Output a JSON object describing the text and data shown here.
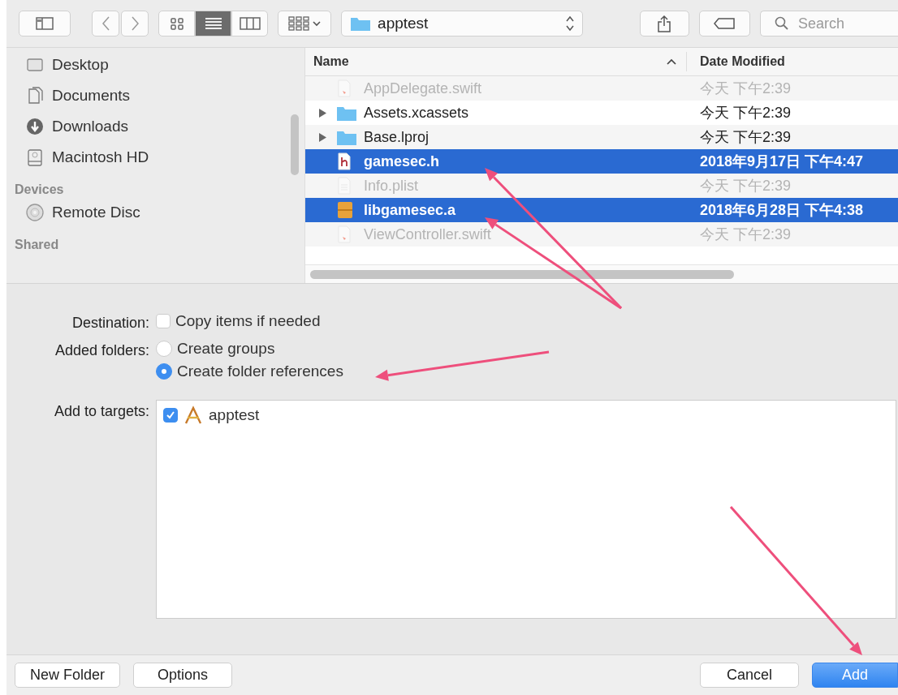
{
  "toolbar": {
    "view_modes": [
      {
        "kind": "icons",
        "selected": false
      },
      {
        "kind": "list",
        "selected": true
      },
      {
        "kind": "columns",
        "selected": false
      }
    ],
    "location": "apptest",
    "search": {
      "placeholder": "Search"
    }
  },
  "sidebar": {
    "sections": [
      {
        "items": [
          {
            "label": "Desktop",
            "kind": "desktop"
          },
          {
            "label": "Documents",
            "kind": "documents"
          },
          {
            "label": "Downloads",
            "kind": "downloads"
          },
          {
            "label": "Macintosh HD",
            "kind": "disk"
          }
        ]
      },
      {
        "heading": "Devices",
        "items": [
          {
            "label": "Remote Disc",
            "kind": "disc"
          }
        ]
      },
      {
        "heading": "Shared"
      }
    ]
  },
  "file_list": {
    "columns": [
      {
        "label": "Name",
        "sorted": true
      },
      {
        "label": "Date Modified",
        "sorted": false
      }
    ],
    "rows": [
      {
        "name": "AppDelegate.swift",
        "date": "今天 下午2:39",
        "kind": "swift",
        "expandable": false,
        "dimmed": true,
        "selected": false
      },
      {
        "name": "Assets.xcassets",
        "date": "今天 下午2:39",
        "kind": "folder",
        "expandable": true,
        "dimmed": false,
        "selected": false
      },
      {
        "name": "Base.lproj",
        "date": "今天 下午2:39",
        "kind": "folder",
        "expandable": true,
        "dimmed": false,
        "selected": false
      },
      {
        "name": "gamesec.h",
        "date": "2018年9月17日 下午4:47",
        "kind": "header",
        "expandable": false,
        "dimmed": false,
        "selected": true
      },
      {
        "name": "Info.plist",
        "date": "今天 下午2:39",
        "kind": "plist",
        "expandable": false,
        "dimmed": true,
        "selected": false
      },
      {
        "name": "libgamesec.a",
        "date": "2018年6月28日 下午4:38",
        "kind": "library",
        "expandable": false,
        "dimmed": false,
        "selected": true
      },
      {
        "name": "ViewController.swift",
        "date": "今天 下午2:39",
        "kind": "swift",
        "expandable": false,
        "dimmed": true,
        "selected": false
      }
    ]
  },
  "options": [
    {
      "label": "Destination:",
      "kind": "checkbox",
      "choices": [
        {
          "text": "Copy items if needed",
          "checked": false
        }
      ]
    },
    {
      "label": "Added folders:",
      "kind": "radio",
      "choices": [
        {
          "text": "Create groups",
          "selected": false
        },
        {
          "text": "Create folder references",
          "selected": true
        }
      ]
    },
    {
      "label": "Add to targets:",
      "kind": "targets",
      "choices": [
        {
          "text": "apptest",
          "checked": true
        }
      ]
    }
  ],
  "left_buttons": [
    {
      "label": "New Folder",
      "kind": "plain"
    },
    {
      "label": "Options",
      "kind": "plain"
    }
  ],
  "right_buttons": [
    {
      "label": "Cancel",
      "kind": "plain"
    },
    {
      "label": "Add",
      "kind": "default"
    }
  ],
  "annotations": [
    {
      "kind": "arrow"
    },
    {
      "kind": "arrow"
    },
    {
      "kind": "arrow"
    },
    {
      "kind": "arrow"
    }
  ]
}
